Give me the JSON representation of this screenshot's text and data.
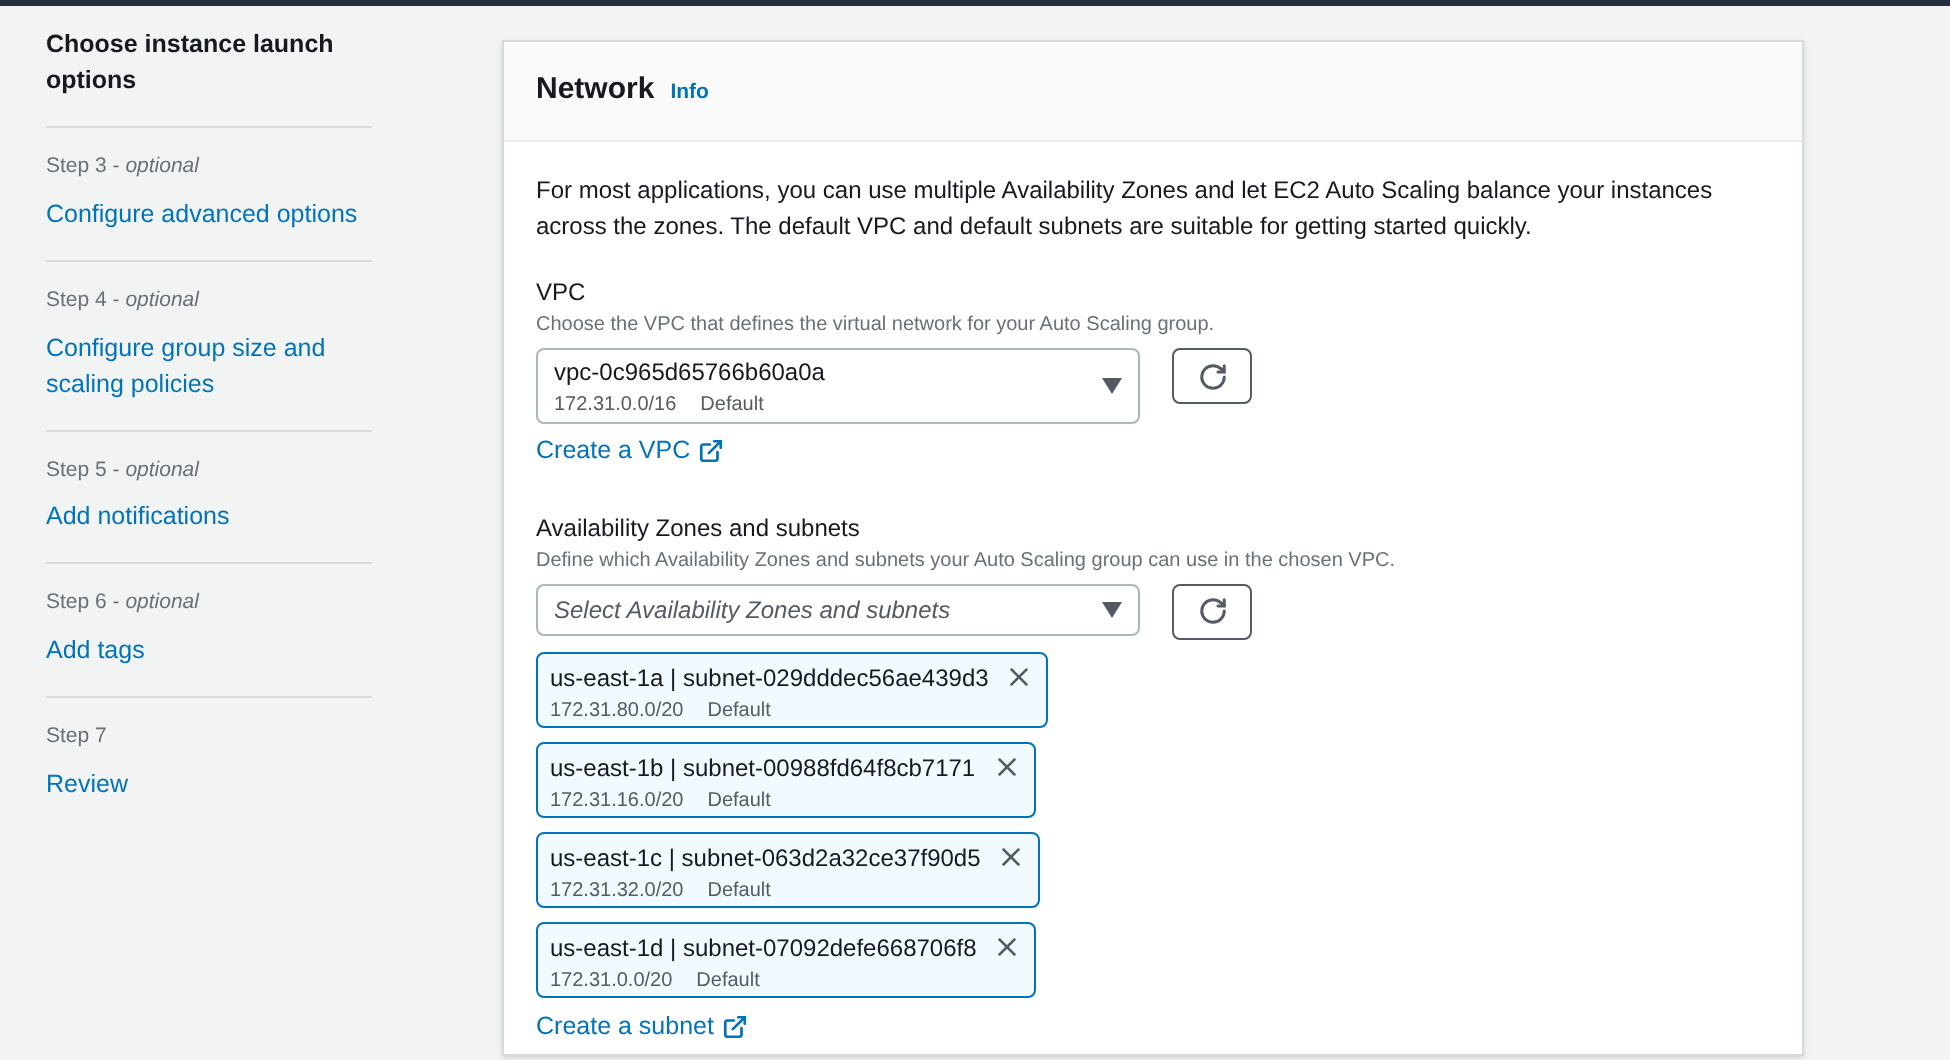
{
  "steps": [
    {
      "title": "Choose instance launch options",
      "selected": true
    },
    {
      "label": "Step 3 - *optional*",
      "title": "Configure advanced options",
      "selected": false
    },
    {
      "label": "Step 4 - *optional*",
      "title": "Configure group size and scaling policies",
      "selected": false
    },
    {
      "label": "Step 5 - *optional*",
      "title": "Add notifications",
      "selected": false
    },
    {
      "label": "Step 6 - *optional*",
      "title": "Add tags",
      "selected": false
    },
    {
      "label": "Step 7",
      "title": "Review",
      "selected": false
    }
  ],
  "panel": {
    "title": "Network",
    "info": "Info",
    "description": "For most applications, you can use multiple Availability Zones and let EC2 Auto Scaling balance your instances across the zones. The default VPC and default subnets are suitable for getting started quickly.",
    "vpc": {
      "label": "VPC",
      "hint": "Choose the VPC that defines the virtual network for your Auto Scaling group.",
      "value": "vpc-0c965d65766b60a0a",
      "cidr": "172.31.0.0/16",
      "tag": "Default",
      "link": "Create a VPC"
    },
    "subnets": {
      "label": "Availability Zones and subnets",
      "hint": "Define which Availability Zones and subnets your Auto Scaling group can use in the chosen VPC.",
      "placeholder": "Select Availability Zones and subnets",
      "tokens": [
        {
          "name": "us-east-1a | subnet-029dddec56ae439d3",
          "cidr": "172.31.80.0/20",
          "tag": "Default"
        },
        {
          "name": "us-east-1b | subnet-00988fd64f8cb7171",
          "cidr": "172.31.16.0/20",
          "tag": "Default"
        },
        {
          "name": "us-east-1c | subnet-063d2a32ce37f90d5",
          "cidr": "172.31.32.0/20",
          "tag": "Default"
        },
        {
          "name": "us-east-1d | subnet-07092defe668706f8",
          "cidr": "172.31.0.0/20",
          "tag": "Default"
        }
      ],
      "link": "Create a subnet"
    }
  }
}
